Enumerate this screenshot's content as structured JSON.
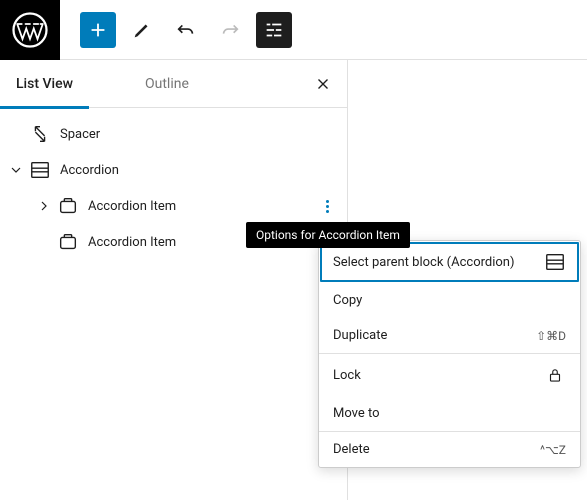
{
  "toolbar": {
    "wp_logo_label": "WordPress",
    "add_label": "Add block",
    "edit_label": "Edit",
    "undo_label": "Undo",
    "redo_label": "Redo",
    "listview_label": "List View"
  },
  "panel": {
    "tab_list_view": "List View",
    "tab_outline": "Outline",
    "close_label": "Close"
  },
  "blocks": {
    "spacer": "Spacer",
    "accordion": "Accordion",
    "item1": "Accordion Item",
    "item2": "Accordion Item"
  },
  "tooltip": {
    "text": "Options for Accordion Item"
  },
  "menu": {
    "select_parent": "Select parent block (Accordion)",
    "copy": "Copy",
    "duplicate": "Duplicate",
    "duplicate_kbd": "⇧⌘D",
    "lock": "Lock",
    "move_to": "Move to",
    "delete": "Delete",
    "delete_kbd": "^⌥Z"
  }
}
